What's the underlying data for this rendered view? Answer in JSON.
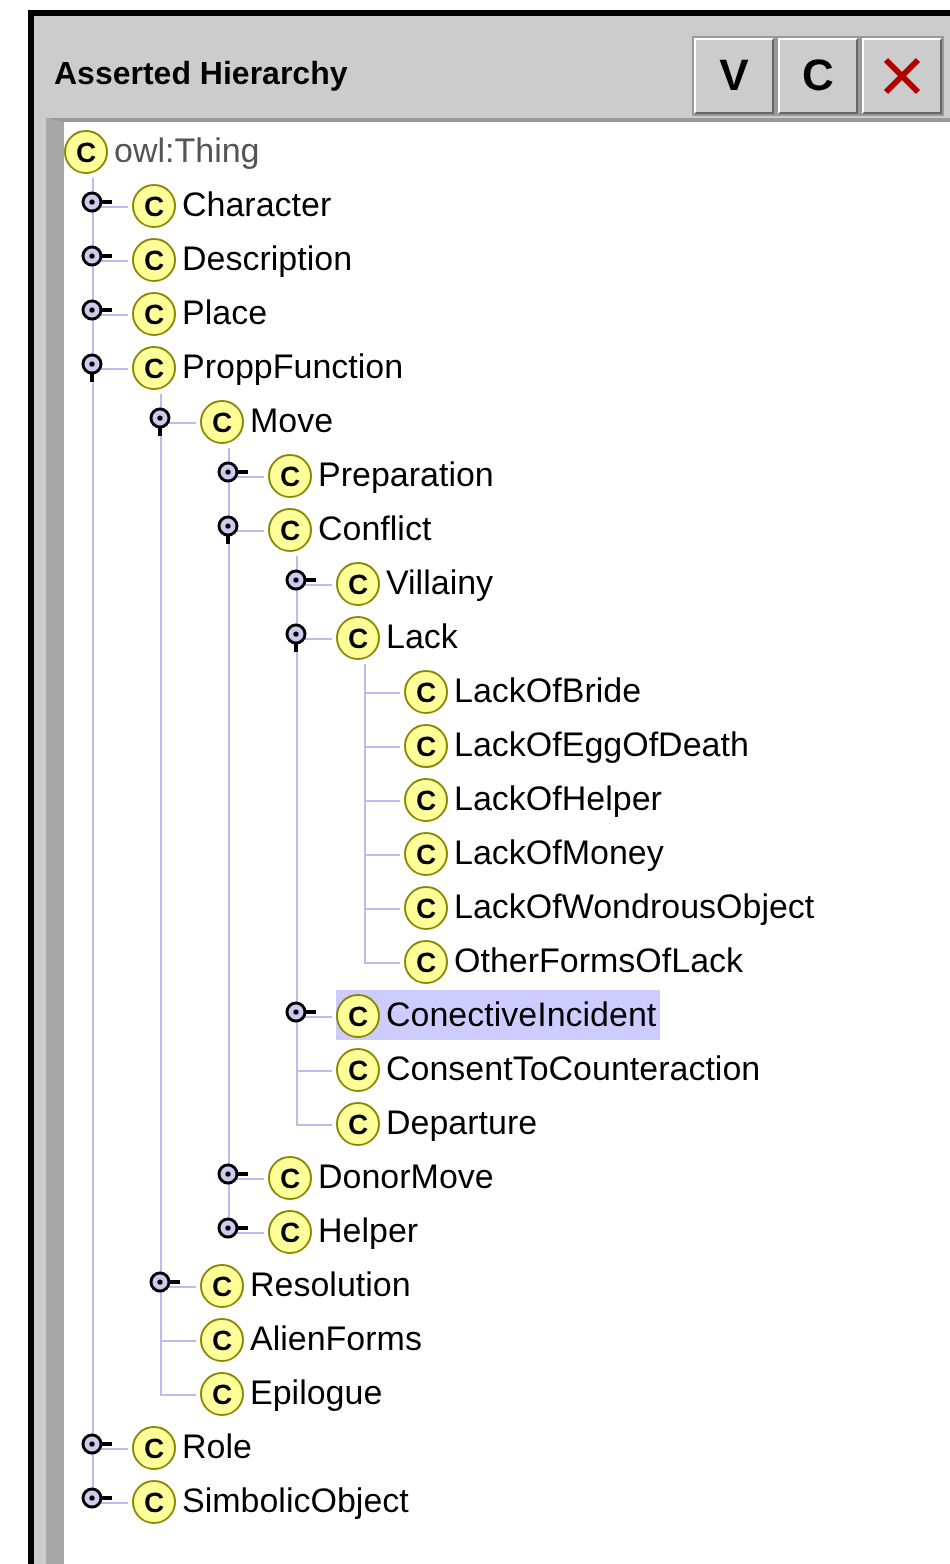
{
  "panel": {
    "title": "Asserted Hierarchy",
    "buttons": [
      {
        "kind": "text",
        "label": "V"
      },
      {
        "kind": "text",
        "label": "C"
      },
      {
        "kind": "delete"
      }
    ]
  },
  "tree": {
    "root": {
      "label": "owl:Thing",
      "badge": "C",
      "selected": false,
      "children": [
        {
          "label": "Character",
          "badge": "C",
          "selected": false,
          "expanded": false
        },
        {
          "label": "Description",
          "badge": "C",
          "selected": false,
          "expanded": false
        },
        {
          "label": "Place",
          "badge": "C",
          "selected": false,
          "expanded": false
        },
        {
          "label": "ProppFunction",
          "badge": "C",
          "selected": false,
          "expanded": true,
          "children": [
            {
              "label": "Move",
              "badge": "C",
              "selected": false,
              "expanded": true,
              "children": [
                {
                  "label": "Preparation",
                  "badge": "C",
                  "selected": false,
                  "expanded": false
                },
                {
                  "label": "Conflict",
                  "badge": "C",
                  "selected": false,
                  "expanded": true,
                  "children": [
                    {
                      "label": "Villainy",
                      "badge": "C",
                      "selected": false,
                      "expanded": false
                    },
                    {
                      "label": "Lack",
                      "badge": "C",
                      "selected": false,
                      "expanded": true,
                      "children": [
                        {
                          "label": "LackOfBride",
                          "badge": "C",
                          "selected": false
                        },
                        {
                          "label": "LackOfEggOfDeath",
                          "badge": "C",
                          "selected": false
                        },
                        {
                          "label": "LackOfHelper",
                          "badge": "C",
                          "selected": false
                        },
                        {
                          "label": "LackOfMoney",
                          "badge": "C",
                          "selected": false
                        },
                        {
                          "label": "LackOfWondrousObject",
                          "badge": "C",
                          "selected": false
                        },
                        {
                          "label": "OtherFormsOfLack",
                          "badge": "C",
                          "selected": false
                        }
                      ]
                    },
                    {
                      "label": "ConectiveIncident",
                      "badge": "C",
                      "selected": true,
                      "expanded": false
                    },
                    {
                      "label": "ConsentToCounteraction",
                      "badge": "C",
                      "selected": false
                    },
                    {
                      "label": "Departure",
                      "badge": "C",
                      "selected": false
                    }
                  ]
                },
                {
                  "label": "DonorMove",
                  "badge": "C",
                  "selected": false,
                  "expanded": false
                },
                {
                  "label": "Helper",
                  "badge": "C",
                  "selected": false,
                  "expanded": false
                }
              ]
            },
            {
              "label": "Resolution",
              "badge": "C",
              "selected": false,
              "expanded": false
            },
            {
              "label": "AlienForms",
              "badge": "C",
              "selected": false
            },
            {
              "label": "Epilogue",
              "badge": "C",
              "selected": false
            }
          ]
        },
        {
          "label": "Role",
          "badge": "C",
          "selected": false,
          "expanded": false
        },
        {
          "label": "SimbolicObject",
          "badge": "C",
          "selected": false,
          "expanded": false
        }
      ]
    }
  }
}
